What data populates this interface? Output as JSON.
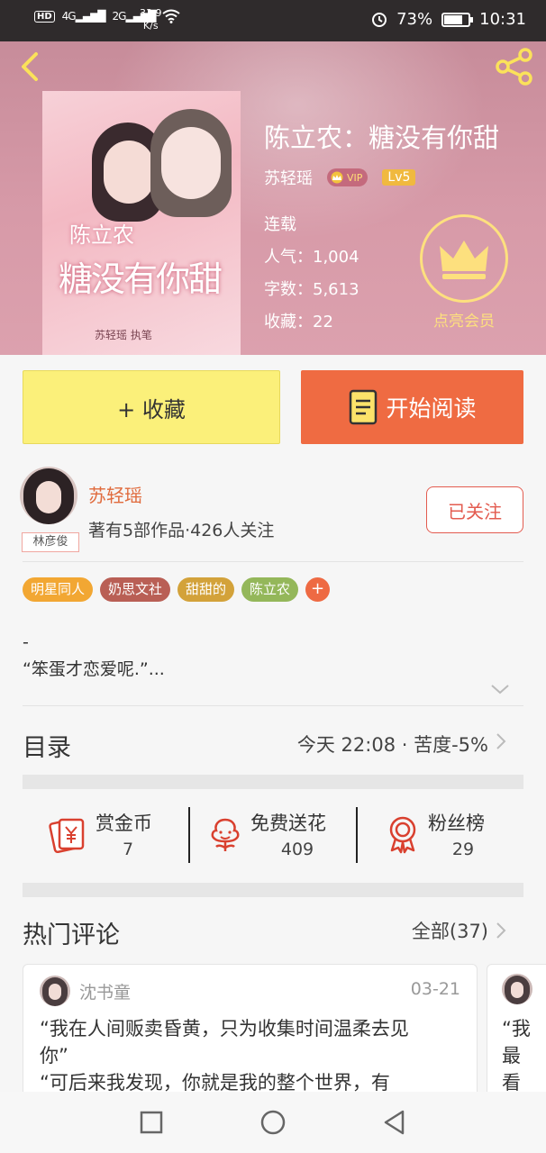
{
  "status_bar": {
    "hd": "HD",
    "signal1": "4G",
    "signal2": "2G",
    "speed_value": "33.9",
    "speed_unit": "K/s",
    "battery": "73%",
    "time": "10:31"
  },
  "book": {
    "title": "陈立农：糖没有你甜",
    "author": "苏轻瑶",
    "vip": "VIP",
    "level": "Lv5",
    "status": "连载",
    "popularity": "人气：1,004",
    "word_count": "字数：5,613",
    "favorites": "收藏：22",
    "cover_line1": "陈立农",
    "cover_line2": "糖没有你甜",
    "cover_line3": "苏轻瑶 执笔"
  },
  "vip_promo": {
    "label": "点亮会员"
  },
  "actions": {
    "collect": "+ 收藏",
    "read": "开始阅读"
  },
  "author_section": {
    "name": "苏轻瑶",
    "info": "著有5部作品·426人关注",
    "avatar_tag": "林彦俊",
    "follow": "已关注"
  },
  "tags": [
    {
      "label": "明星同人",
      "color": "#f2a733"
    },
    {
      "label": "奶思文社",
      "color": "#b95f55"
    },
    {
      "label": "甜甜的",
      "color": "#d3a23a"
    },
    {
      "label": "陈立农",
      "color": "#94b75a"
    }
  ],
  "tag_add": "+",
  "description": {
    "line1": "-",
    "line2": "“笨蛋才恋爱呢.”..."
  },
  "catalog": {
    "title": "目录",
    "update": "今天 22:08 · 苦度-5%"
  },
  "rewards": [
    {
      "label": "赏金币",
      "count": "7",
      "icon": "red-envelope-icon"
    },
    {
      "label": "免费送花",
      "count": "409",
      "icon": "flower-icon"
    },
    {
      "label": "粉丝榜",
      "count": "29",
      "icon": "medal-icon"
    }
  ],
  "comments": {
    "title": "热门评论",
    "all": "全部(37)",
    "items": [
      {
        "user": "沈书童",
        "date": "03-21",
        "line1": "“我在人间贩卖昏黄，只为收集时间温柔去见",
        "line2": "你”",
        "line3": "“可后来我发现，你就是我的整个世界，有"
      }
    ],
    "second_preview": {
      "line1": "“我",
      "line2": "最",
      "line3": "看"
    }
  },
  "colors": {
    "accent": "#ef6b42",
    "collect_bg": "#fbf07a",
    "header_bg": "#d79aa8",
    "vip_gold": "#fde07e"
  }
}
